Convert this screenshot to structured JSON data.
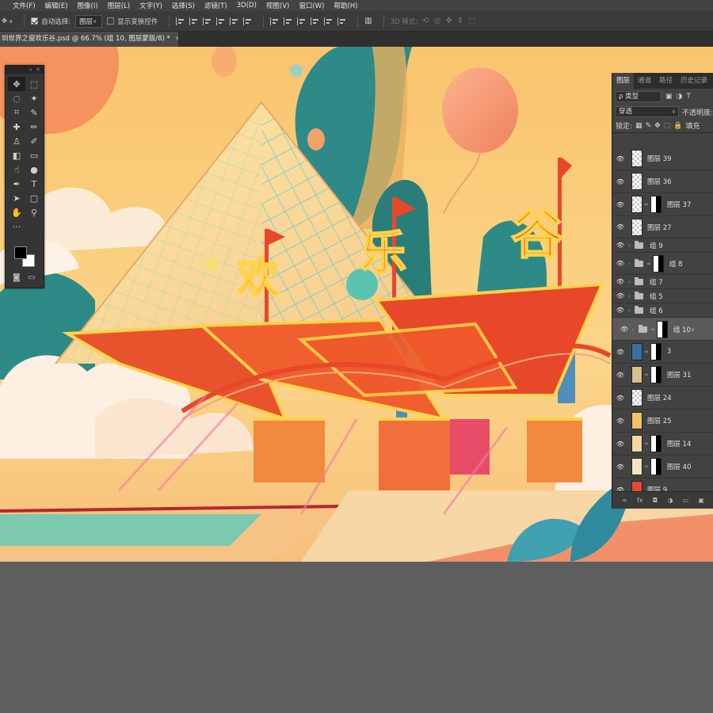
{
  "menu": [
    "文件(F)",
    "编辑(E)",
    "图像(I)",
    "图层(L)",
    "文字(Y)",
    "选择(S)",
    "滤镜(T)",
    "3D(D)",
    "视图(V)",
    "窗口(W)",
    "帮助(H)"
  ],
  "options": {
    "auto_select_label": "自动选择:",
    "auto_select_value": "图层",
    "show_transform_label": "显示变换控件",
    "mode_3d_label": "3D 模式:"
  },
  "document": {
    "tab_title": "圳世界之窗欢乐谷.psd @ 66.7% (组 10, 图层蒙版/8) *",
    "close_glyph": "×"
  },
  "artwork": {
    "char1": "欢",
    "char2": "乐",
    "char3": "谷"
  },
  "tools": [
    "move-tool",
    "marquee-tool",
    "lasso-tool",
    "magic-wand-tool",
    "crop-tool",
    "eyedropper-tool",
    "heal-tool",
    "brush-tool",
    "stamp-tool",
    "history-brush-tool",
    "eraser-tool",
    "gradient-tool",
    "smudge-tool",
    "dodge-tool",
    "pen-tool",
    "type-tool",
    "path-select-tool",
    "shape-tool",
    "hand-tool",
    "zoom-tool"
  ],
  "tool_glyphs": [
    "✥",
    "⬚",
    "◌",
    "✦",
    "⌗",
    "✎",
    "✚",
    "✏",
    "♙",
    "✐",
    "◧",
    "▭",
    "☝",
    "●",
    "✒",
    "T",
    "➤",
    "▢",
    "✋",
    "⚲"
  ],
  "extra_glyph": "···",
  "layers_panel": {
    "tabs": [
      "图层",
      "通道",
      "路径",
      "历史记录"
    ],
    "filter_label": "ρ 类型",
    "blend_mode": "穿透",
    "opacity_label": "不透明度:",
    "lock_label": "锁定:",
    "fill_label": "填充",
    "footer": [
      "∞",
      "fx",
      "◘",
      "◑",
      "▭",
      "▣"
    ],
    "layers": [
      {
        "name": "图层 39",
        "kind": "layer",
        "mask": false
      },
      {
        "name": "图层 36",
        "kind": "layer",
        "mask": false
      },
      {
        "name": "图层 37",
        "kind": "layer",
        "mask": true
      },
      {
        "name": "图层 27",
        "kind": "layer",
        "mask": false
      },
      {
        "name": "组 9",
        "kind": "group",
        "mask": false
      },
      {
        "name": "组 8",
        "kind": "group",
        "mask": true
      },
      {
        "name": "组 7",
        "kind": "group",
        "mask": false
      },
      {
        "name": "组 5",
        "kind": "group",
        "mask": false
      },
      {
        "name": "组 6",
        "kind": "group",
        "mask": false
      },
      {
        "name": "组 10",
        "kind": "group",
        "mask": true,
        "selected": true
      },
      {
        "name": "3",
        "kind": "layer",
        "mask": true
      },
      {
        "name": "图层 31",
        "kind": "layer",
        "mask": true
      },
      {
        "name": "图层 24",
        "kind": "layer",
        "mask": false
      },
      {
        "name": "图层 25",
        "kind": "layer",
        "mask": false
      },
      {
        "name": "图层 14",
        "kind": "layer",
        "mask": true
      },
      {
        "name": "图层 40",
        "kind": "layer",
        "mask": true
      },
      {
        "name": "图层 9",
        "kind": "layer",
        "mask": false
      }
    ]
  },
  "colors": {
    "accent": "#e8482a",
    "sky": "#f9c36a",
    "teal": "#2f8f86"
  }
}
